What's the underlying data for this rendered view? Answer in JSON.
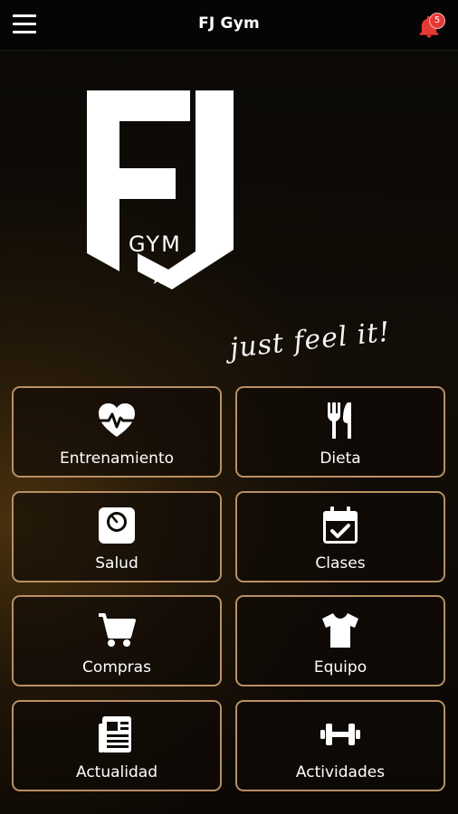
{
  "app_bar": {
    "title": "FJ Gym",
    "menu_icon": "hamburger-menu-icon",
    "notification_icon": "bell-icon",
    "notification_count": "5",
    "badge_color": "#e53935"
  },
  "logo": {
    "letters": "FJ",
    "sub": "GYM",
    "tagline": "just feel it!"
  },
  "tiles": [
    {
      "label": "Entrenamiento",
      "icon": "heartbeat-icon"
    },
    {
      "label": "Dieta",
      "icon": "fork-knife-icon"
    },
    {
      "label": "Salud",
      "icon": "weight-scale-icon"
    },
    {
      "label": "Clases",
      "icon": "calendar-check-icon"
    },
    {
      "label": "Compras",
      "icon": "shopping-cart-icon"
    },
    {
      "label": "Equipo",
      "icon": "t-shirt-icon"
    },
    {
      "label": "Actualidad",
      "icon": "newspaper-icon"
    },
    {
      "label": "Actividades",
      "icon": "dumbbell-icon"
    }
  ],
  "theme": {
    "tile_border": "#b98f63",
    "background": "#070503",
    "accent_glow": "#785014"
  }
}
